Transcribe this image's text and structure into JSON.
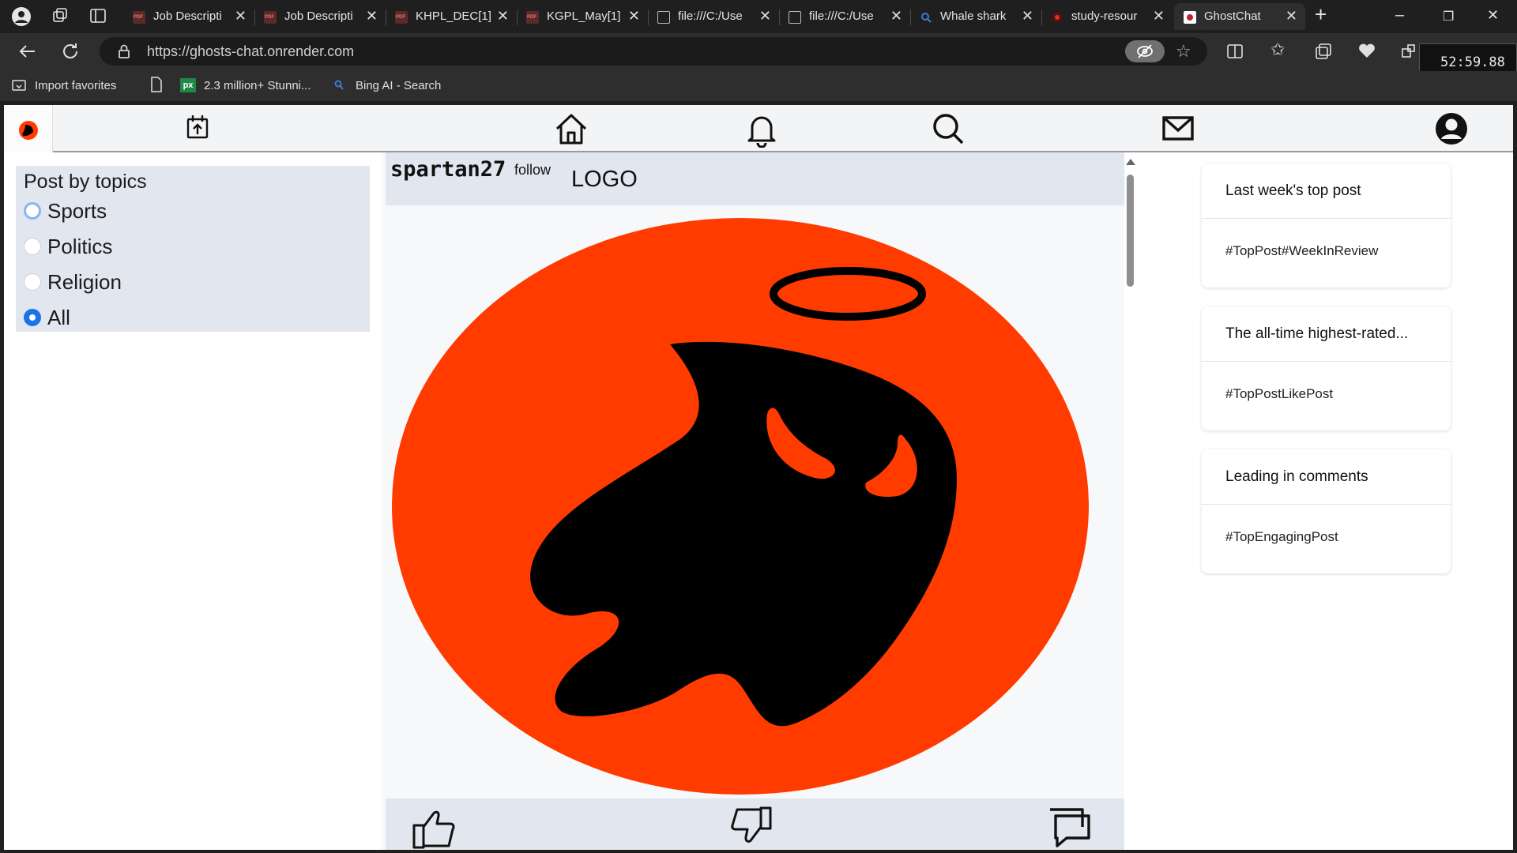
{
  "browser": {
    "tabs": [
      {
        "title": "Job Descripti",
        "favicon": "pdf-icon"
      },
      {
        "title": "Job Descripti",
        "favicon": "pdf-icon"
      },
      {
        "title": "KHPL_DEC[1]",
        "favicon": "pdf-icon"
      },
      {
        "title": "KGPL_May[1]",
        "favicon": "pdf-icon"
      },
      {
        "title": "file:///C:/Use",
        "favicon": "file-icon"
      },
      {
        "title": "file:///C:/Use",
        "favicon": "file-icon"
      },
      {
        "title": "Whale shark",
        "favicon": "search-icon"
      },
      {
        "title": "study-resour",
        "favicon": "site-icon"
      },
      {
        "title": "GhostChat",
        "favicon": "ghostchat-icon",
        "active": true
      }
    ],
    "url": "https://ghosts-chat.onrender.com",
    "favorites": [
      {
        "label": "Import favorites"
      },
      {
        "label": ""
      },
      {
        "label": "2.3 million+ Stunni..."
      },
      {
        "label": "Bing AI - Search"
      }
    ],
    "timer": "52:59.88"
  },
  "app": {
    "colors": {
      "brand": "#ff3b00",
      "panel": "#e1e6ef",
      "radio_on": "#1a73e8"
    },
    "topics": {
      "title": "Post by topics",
      "options": [
        "Sports",
        "Politics",
        "Religion",
        "All"
      ],
      "selected": "All"
    },
    "post": {
      "username": "spartan27",
      "follow_label": "follow",
      "logo_label": "LOGO"
    },
    "cards": [
      {
        "title": "Last week's top post",
        "body": "#TopPost#WeekInReview"
      },
      {
        "title": "The all-time highest-rated...",
        "body": "#TopPostLikePost"
      },
      {
        "title": "Leading in comments",
        "body": "#TopEngagingPost"
      }
    ]
  }
}
